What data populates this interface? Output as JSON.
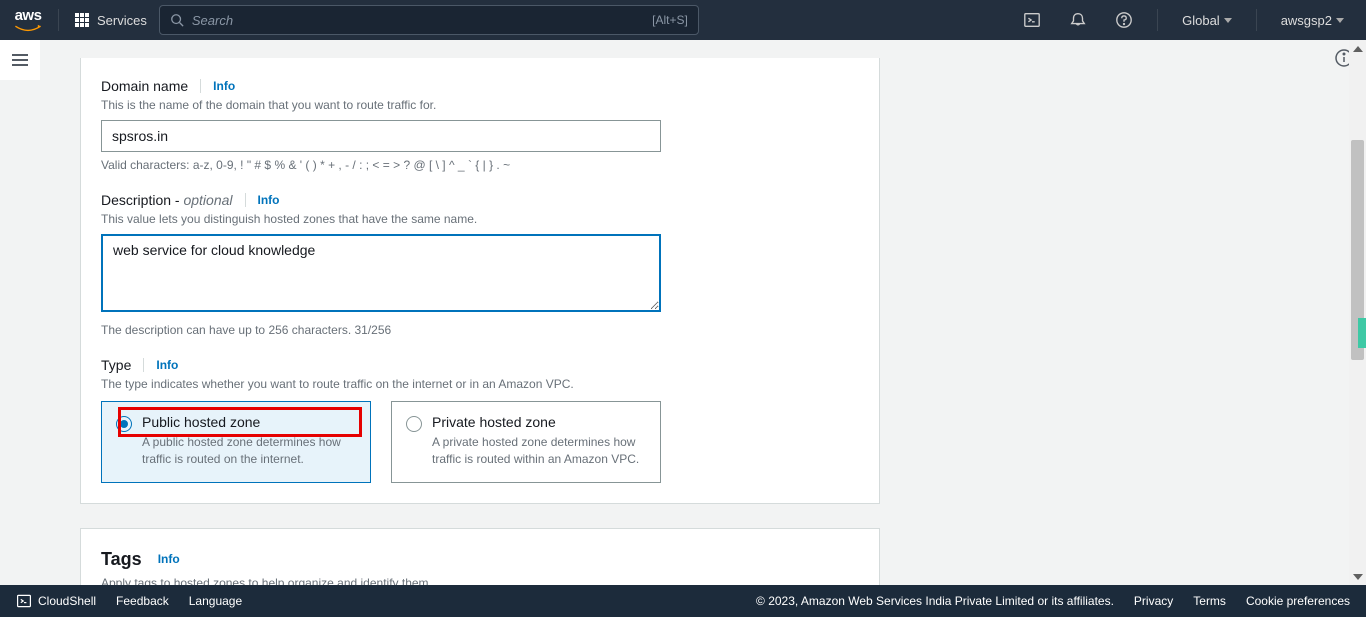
{
  "topbar": {
    "services_label": "Services",
    "search_placeholder": "Search",
    "search_shortcut": "[Alt+S]",
    "region": "Global",
    "account": "awsgsp2"
  },
  "domain": {
    "label": "Domain name",
    "info": "Info",
    "desc": "This is the name of the domain that you want to route traffic for.",
    "value": "spsros.in",
    "hint": "Valid characters: a-z, 0-9, ! \" # $ % & ' ( ) * + , - / : ; < = > ? @ [ \\ ] ^ _ ` { | } . ~"
  },
  "description": {
    "label_prefix": "Description - ",
    "label_suffix": "optional",
    "info": "Info",
    "desc": "This value lets you distinguish hosted zones that have the same name.",
    "value": "web service for cloud knowledge",
    "hint": "The description can have up to 256 characters. 31/256"
  },
  "type": {
    "label": "Type",
    "info": "Info",
    "desc": "The type indicates whether you want to route traffic on the internet or in an Amazon VPC.",
    "public": {
      "title": "Public hosted zone",
      "desc": "A public hosted zone determines how traffic is routed on the internet."
    },
    "private": {
      "title": "Private hosted zone",
      "desc": "A private hosted zone determines how traffic is routed within an Amazon VPC."
    }
  },
  "tags": {
    "title": "Tags",
    "info": "Info",
    "desc": "Apply tags to hosted zones to help organize and identify them."
  },
  "footer": {
    "cloudshell": "CloudShell",
    "feedback": "Feedback",
    "language": "Language",
    "copyright": "© 2023, Amazon Web Services India Private Limited or its affiliates.",
    "privacy": "Privacy",
    "terms": "Terms",
    "cookies": "Cookie preferences"
  }
}
